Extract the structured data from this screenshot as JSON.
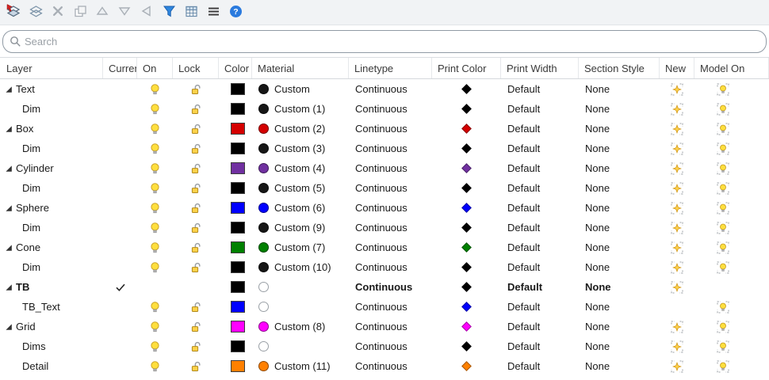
{
  "toolbar": {
    "icons": [
      {
        "name": "new-layer",
        "disabled": false
      },
      {
        "name": "new-sublayer",
        "disabled": false
      },
      {
        "name": "delete-layer",
        "disabled": true
      },
      {
        "name": "duplicate-layer",
        "disabled": true
      },
      {
        "name": "move-up",
        "disabled": true
      },
      {
        "name": "move-down",
        "disabled": true
      },
      {
        "name": "move-left",
        "disabled": true
      },
      {
        "name": "filter",
        "disabled": false
      },
      {
        "name": "columns",
        "disabled": false
      },
      {
        "name": "menu",
        "disabled": false
      },
      {
        "name": "help",
        "disabled": false
      }
    ]
  },
  "search": {
    "placeholder": "Search"
  },
  "table": {
    "columns": [
      "Layer",
      "Current",
      "On",
      "Lock",
      "Color",
      "Material",
      "Linetype",
      "Print Color",
      "Print Width",
      "Section Style",
      "New",
      "Model On"
    ],
    "rows": [
      {
        "name": "Text",
        "indent": 0,
        "expandable": true,
        "current": false,
        "bold": false,
        "on": true,
        "lock": true,
        "color": "#000000",
        "material_color": "#161616",
        "material": "Custom",
        "linetype": "Continuous",
        "print_color": "#000000",
        "print_width": "Default",
        "section_style": "None",
        "new_detail": true,
        "model_on": true
      },
      {
        "name": "Dim",
        "indent": 1,
        "expandable": false,
        "current": false,
        "bold": false,
        "on": true,
        "lock": true,
        "color": "#000000",
        "material_color": "#161616",
        "material": "Custom (1)",
        "linetype": "Continuous",
        "print_color": "#000000",
        "print_width": "Default",
        "section_style": "None",
        "new_detail": true,
        "model_on": true
      },
      {
        "name": "Box",
        "indent": 0,
        "expandable": true,
        "current": false,
        "bold": false,
        "on": true,
        "lock": true,
        "color": "#d40000",
        "material_color": "#d40000",
        "material": "Custom (2)",
        "linetype": "Continuous",
        "print_color": "#d40000",
        "print_width": "Default",
        "section_style": "None",
        "new_detail": true,
        "model_on": true
      },
      {
        "name": "Dim",
        "indent": 1,
        "expandable": false,
        "current": false,
        "bold": false,
        "on": true,
        "lock": true,
        "color": "#000000",
        "material_color": "#161616",
        "material": "Custom (3)",
        "linetype": "Continuous",
        "print_color": "#000000",
        "print_width": "Default",
        "section_style": "None",
        "new_detail": true,
        "model_on": true
      },
      {
        "name": "Cylinder",
        "indent": 0,
        "expandable": true,
        "current": false,
        "bold": false,
        "on": true,
        "lock": true,
        "color": "#7030a0",
        "material_color": "#7030a0",
        "material": "Custom (4)",
        "linetype": "Continuous",
        "print_color": "#7030a0",
        "print_width": "Default",
        "section_style": "None",
        "new_detail": true,
        "model_on": true
      },
      {
        "name": "Dim",
        "indent": 1,
        "expandable": false,
        "current": false,
        "bold": false,
        "on": true,
        "lock": true,
        "color": "#000000",
        "material_color": "#161616",
        "material": "Custom (5)",
        "linetype": "Continuous",
        "print_color": "#000000",
        "print_width": "Default",
        "section_style": "None",
        "new_detail": true,
        "model_on": true
      },
      {
        "name": "Sphere",
        "indent": 0,
        "expandable": true,
        "current": false,
        "bold": false,
        "on": true,
        "lock": true,
        "color": "#0000ff",
        "material_color": "#0000ff",
        "material": "Custom (6)",
        "linetype": "Continuous",
        "print_color": "#0000ff",
        "print_width": "Default",
        "section_style": "None",
        "new_detail": true,
        "model_on": true
      },
      {
        "name": "Dim",
        "indent": 1,
        "expandable": false,
        "current": false,
        "bold": false,
        "on": true,
        "lock": true,
        "color": "#000000",
        "material_color": "#161616",
        "material": "Custom (9)",
        "linetype": "Continuous",
        "print_color": "#000000",
        "print_width": "Default",
        "section_style": "None",
        "new_detail": true,
        "model_on": true
      },
      {
        "name": "Cone",
        "indent": 0,
        "expandable": true,
        "current": false,
        "bold": false,
        "on": true,
        "lock": true,
        "color": "#008000",
        "material_color": "#008000",
        "material": "Custom (7)",
        "linetype": "Continuous",
        "print_color": "#008000",
        "print_width": "Default",
        "section_style": "None",
        "new_detail": true,
        "model_on": true
      },
      {
        "name": "Dim",
        "indent": 1,
        "expandable": false,
        "current": false,
        "bold": false,
        "on": true,
        "lock": true,
        "color": "#000000",
        "material_color": "#161616",
        "material": "Custom (10)",
        "linetype": "Continuous",
        "print_color": "#000000",
        "print_width": "Default",
        "section_style": "None",
        "new_detail": true,
        "model_on": true
      },
      {
        "name": "TB",
        "indent": 0,
        "expandable": true,
        "current": true,
        "bold": true,
        "on": false,
        "lock": false,
        "color": "#000000",
        "material_color": null,
        "material": "",
        "linetype": "Continuous",
        "print_color": "#000000",
        "print_width": "Default",
        "section_style": "None",
        "new_detail": true,
        "model_on": false
      },
      {
        "name": "TB_Text",
        "indent": 1,
        "expandable": false,
        "current": false,
        "bold": false,
        "on": true,
        "lock": true,
        "color": "#0000ff",
        "material_color": null,
        "material": "",
        "linetype": "Continuous",
        "print_color": "#0000ff",
        "print_width": "Default",
        "section_style": "None",
        "new_detail": false,
        "model_on": true
      },
      {
        "name": "Grid",
        "indent": 0,
        "expandable": true,
        "current": false,
        "bold": false,
        "on": true,
        "lock": true,
        "color": "#ff00ff",
        "material_color": "#ff00ff",
        "material": "Custom (8)",
        "linetype": "Continuous",
        "print_color": "#ff00ff",
        "print_width": "Default",
        "section_style": "None",
        "new_detail": true,
        "model_on": true
      },
      {
        "name": "Dims",
        "indent": 1,
        "expandable": false,
        "current": false,
        "bold": false,
        "on": true,
        "lock": true,
        "color": "#000000",
        "material_color": null,
        "material": "",
        "linetype": "Continuous",
        "print_color": "#000000",
        "print_width": "Default",
        "section_style": "None",
        "new_detail": true,
        "model_on": true
      },
      {
        "name": "Detail",
        "indent": 1,
        "expandable": false,
        "current": false,
        "bold": false,
        "on": true,
        "lock": true,
        "color": "#ff8000",
        "material_color": "#ff8000",
        "material": "Custom (11)",
        "linetype": "Continuous",
        "print_color": "#ff8000",
        "print_width": "Default",
        "section_style": "None",
        "new_detail": true,
        "model_on": true
      }
    ]
  }
}
